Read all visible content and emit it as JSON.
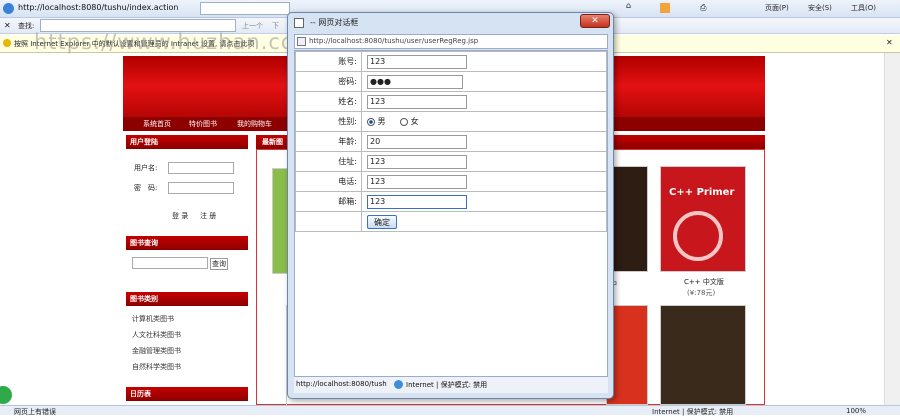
{
  "browser": {
    "url": "http://localhost:8080/tushu/index.action",
    "search_label": "查找:",
    "prev_label": "上一个",
    "next_label": "下",
    "menu_page": "页面(P)",
    "menu_safety": "安全(S)",
    "menu_tools": "工具(O)",
    "infobar_text": "按照 Internet Explorer 中的默认设置和管理员的 Intranet 设置, 请点击此项"
  },
  "site": {
    "nav": [
      "系统首页",
      "特价图书",
      "我的购物车"
    ],
    "login_title": "用户登陆",
    "user_label": "用户名:",
    "pass_label": "密　码:",
    "login_btn": "登 录",
    "register_btn": "注 册",
    "search_title": "图书查询",
    "search_btn": "查询",
    "category_title": "图书类别",
    "categories": [
      "计算机类图书",
      "人文社科类图书",
      "金融管理类图书",
      "自然科学类图书"
    ],
    "calendar_title": "日历表",
    "newbooks_title": "最新图",
    "book_title": "C++ 中文版",
    "book_price": "(¥:78元)",
    "book_prefix": "中"
  },
  "dialog": {
    "title": "-- 网页对话框",
    "address": "http://localhost:8080/tushu/user/userRegReg.jsp",
    "fields": [
      {
        "label": "账号:",
        "value": "123"
      },
      {
        "label": "密码:",
        "value": "●●●"
      },
      {
        "label": "姓名:",
        "value": "123"
      },
      {
        "label": "性别:",
        "male": "男",
        "female": "女"
      },
      {
        "label": "年龄:",
        "value": "20"
      },
      {
        "label": "住址:",
        "value": "123"
      },
      {
        "label": "电话:",
        "value": "123"
      },
      {
        "label": "邮箱:",
        "value": "123"
      }
    ],
    "submit": "确定",
    "status_url": "http://localhost:8080/tush",
    "status_zone": "Internet | 保护模式: 禁用"
  },
  "statusbar": {
    "left": "网页上有错误",
    "zone": "Internet | 保护模式: 禁用",
    "zoom": "100%"
  },
  "watermark": "https://www.huzhan.com/ishop39597",
  "colors": {
    "accent_red": "#b00000"
  }
}
